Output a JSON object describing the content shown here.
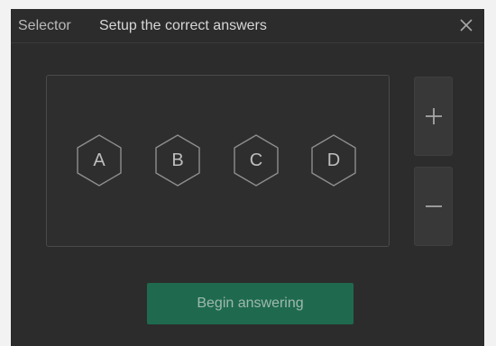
{
  "window": {
    "app_title": "Selector",
    "subtitle": "Setup the correct answers",
    "close_icon": "close-icon"
  },
  "options": [
    {
      "label": "A"
    },
    {
      "label": "B"
    },
    {
      "label": "C"
    },
    {
      "label": "D"
    }
  ],
  "controls": {
    "add_icon": "plus-icon",
    "remove_icon": "minus-icon"
  },
  "actions": {
    "begin_label": "Begin answering"
  },
  "colors": {
    "window_bg": "#2c2c2c",
    "accent": "#1f6a4e",
    "text": "#bdbdbd"
  }
}
